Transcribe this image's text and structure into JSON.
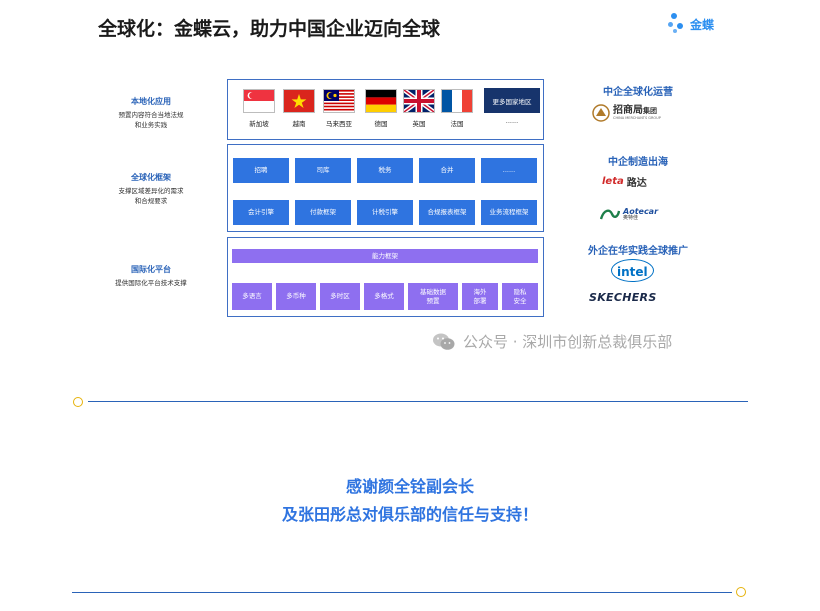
{
  "title": "全球化：金蝶云，助力中国企业迈向全球",
  "logo_text": "金蝶",
  "rows": [
    {
      "heading": "本地化应用",
      "desc1": "预置内容符合当地法规",
      "desc2": "和业务实践"
    },
    {
      "heading": "全球化框架",
      "desc1": "支撑区域差异化的需求",
      "desc2": "和合规要求"
    },
    {
      "heading": "国际化平台",
      "desc1": "提供国际化平台技术支撑",
      "desc2": ""
    }
  ],
  "flags": [
    "新加坡",
    "越南",
    "马来西亚",
    "德国",
    "英国",
    "法国"
  ],
  "more_regions": "更多国家地区",
  "more_dots": "......",
  "framework_row1": [
    "招聘",
    "司库",
    "税务",
    "合并",
    "......"
  ],
  "framework_row2": [
    "会计引擎",
    "付款框架",
    "计税引擎",
    "合规报表框架",
    "业务流程框架"
  ],
  "platform_header": "能力框架",
  "platform_items": [
    "多语言",
    "多币种",
    "多时区",
    "多格式",
    "基础数据\n预置",
    "海外\n部署",
    "隐私\n安全"
  ],
  "right": {
    "h1": "中企全球化运营",
    "brand1_cn": "招商局",
    "brand1_cn2": "集团",
    "brand1_en": "CHINA MERCHANTS GROUP",
    "h2": "中企制造出海",
    "brand2_logo": "leta",
    "brand2_cn": "路达",
    "brand3_en": "Aotecar",
    "brand3_cn": "奥特佳",
    "h3": "外企在华实践全球推广",
    "brand4": "intel",
    "brand5": "SKECHERS"
  },
  "watermark": "公众号 · 深圳市创新总裁俱乐部",
  "thanks_line1": "感谢颜全铨副会长",
  "thanks_line2": "及张田彤总对俱乐部的信任与支持！"
}
